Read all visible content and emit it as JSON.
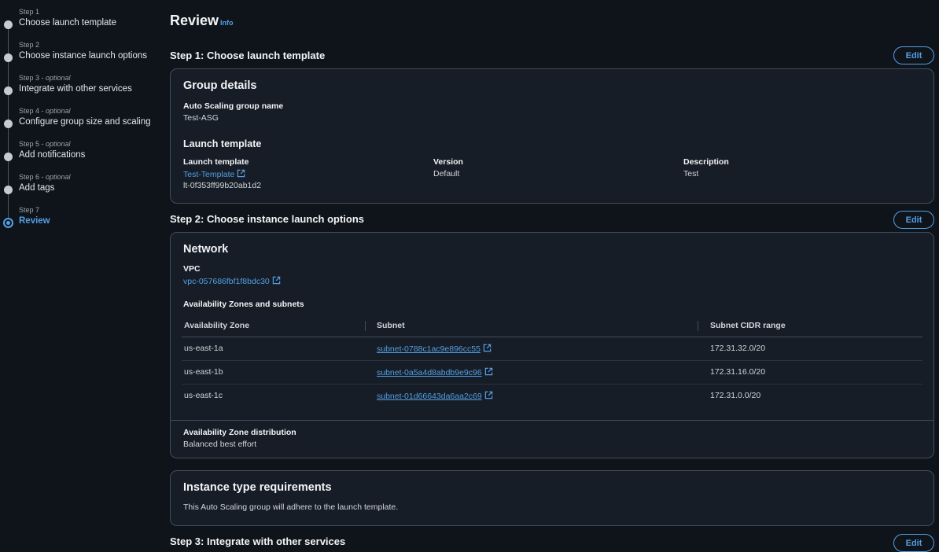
{
  "wizard": {
    "steps": [
      {
        "num": "Step 1",
        "optional": "",
        "title": "Choose launch template"
      },
      {
        "num": "Step 2",
        "optional": "",
        "title": "Choose instance launch options"
      },
      {
        "num": "Step 3 - ",
        "optional": "optional",
        "title": "Integrate with other services"
      },
      {
        "num": "Step 4 - ",
        "optional": "optional",
        "title": "Configure group size and scaling"
      },
      {
        "num": "Step 5 - ",
        "optional": "optional",
        "title": "Add notifications"
      },
      {
        "num": "Step 6 - ",
        "optional": "optional",
        "title": "Add tags"
      },
      {
        "num": "Step 7",
        "optional": "",
        "title": "Review"
      }
    ],
    "active_step": "Review"
  },
  "page": {
    "title": "Review",
    "info": "Info"
  },
  "edit_label": "Edit",
  "step1": {
    "heading": "Step 1: Choose launch template",
    "group_details": {
      "heading": "Group details",
      "name_label": "Auto Scaling group name",
      "name_value": "Test-ASG"
    },
    "launch_template": {
      "heading": "Launch template",
      "lt_label": "Launch template",
      "lt_link": "Test-Template",
      "lt_id": "lt-0f353ff99b20ab1d2",
      "version_label": "Version",
      "version_value": "Default",
      "desc_label": "Description",
      "desc_value": "Test"
    }
  },
  "step2": {
    "heading": "Step 2: Choose instance launch options",
    "network": {
      "heading": "Network",
      "vpc_label": "VPC",
      "vpc_link": "vpc-057686fbf1f8bdc30",
      "az_heading": "Availability Zones and subnets",
      "columns": [
        "Availability Zone",
        "Subnet",
        "Subnet CIDR range"
      ],
      "rows": [
        {
          "az": "us-east-1a",
          "subnet": "subnet-0788c1ac9e896cc55",
          "cidr": "172.31.32.0/20"
        },
        {
          "az": "us-east-1b",
          "subnet": "subnet-0a5a4d8abdb9e9c96",
          "cidr": "172.31.16.0/20"
        },
        {
          "az": "us-east-1c",
          "subnet": "subnet-01d66643da6aa2c69",
          "cidr": "172.31.0.0/20"
        }
      ],
      "dist_label": "Availability Zone distribution",
      "dist_value": "Balanced best effort"
    },
    "instance_req": {
      "heading": "Instance type requirements",
      "text": "This Auto Scaling group will adhere to the launch template."
    }
  },
  "step3": {
    "heading": "Step 3: Integrate with other services"
  },
  "colors": {
    "accent": "#539fe5",
    "background": "#0f141a",
    "card": "#161d26",
    "border": "#414d5c"
  }
}
